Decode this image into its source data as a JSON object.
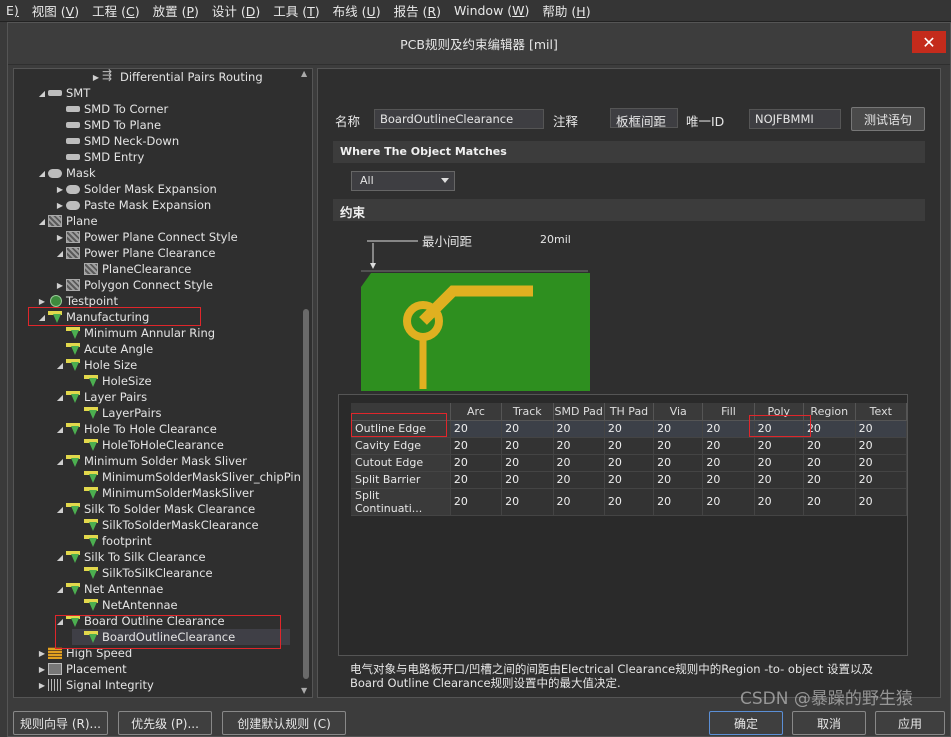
{
  "menubar": {
    "items": [
      {
        "label": "E",
        "key": ")"
      },
      {
        "label": "视图 (",
        "key": "V",
        "end": ")"
      },
      {
        "label": "工程 (",
        "key": "C",
        "end": ")"
      },
      {
        "label": "放置 (",
        "key": "P",
        "end": ")"
      },
      {
        "label": "设计 (",
        "key": "D",
        "end": ")"
      },
      {
        "label": "工具 (",
        "key": "T",
        "end": ")"
      },
      {
        "label": "布线 (",
        "key": "U",
        "end": ")"
      },
      {
        "label": "报告 (",
        "key": "R",
        "end": ")"
      },
      {
        "label": "Window (",
        "key": "W",
        "end": ")"
      },
      {
        "label": "帮助 (",
        "key": "H",
        "end": ")"
      }
    ]
  },
  "dialog": {
    "title": "PCB规则及约束编辑器 [mil]",
    "close": "✕"
  },
  "tree": {
    "items": [
      {
        "label": "Differential Pairs Routing",
        "arrow": "▶",
        "icon": "diff"
      },
      {
        "label": "SMT",
        "arrow": "◢",
        "icon": "smt"
      },
      {
        "label": "SMD To Corner",
        "arrow": "",
        "icon": "smt"
      },
      {
        "label": "SMD To Plane",
        "arrow": "",
        "icon": "smt"
      },
      {
        "label": "SMD Neck-Down",
        "arrow": "",
        "icon": "smt"
      },
      {
        "label": "SMD Entry",
        "arrow": "",
        "icon": "smt"
      },
      {
        "label": "Mask",
        "arrow": "◢",
        "icon": "pill"
      },
      {
        "label": "Solder Mask Expansion",
        "arrow": "▶",
        "icon": "pill"
      },
      {
        "label": "Paste Mask Expansion",
        "arrow": "▶",
        "icon": "pill"
      },
      {
        "label": "Plane",
        "arrow": "◢",
        "icon": "checker"
      },
      {
        "label": "Power Plane Connect Style",
        "arrow": "▶",
        "icon": "checker"
      },
      {
        "label": "Power Plane Clearance",
        "arrow": "◢",
        "icon": "checker"
      },
      {
        "label": "PlaneClearance",
        "arrow": "",
        "icon": "checker"
      },
      {
        "label": "Polygon Connect Style",
        "arrow": "▶",
        "icon": "checker"
      },
      {
        "label": "Testpoint",
        "arrow": "▶",
        "icon": "testpoint"
      },
      {
        "label": "Manufacturing",
        "arrow": "◢",
        "icon": "mfg"
      },
      {
        "label": "Minimum Annular Ring",
        "arrow": "",
        "icon": "mfg"
      },
      {
        "label": "Acute Angle",
        "arrow": "",
        "icon": "mfg"
      },
      {
        "label": "Hole Size",
        "arrow": "◢",
        "icon": "mfg"
      },
      {
        "label": "HoleSize",
        "arrow": "",
        "icon": "mfg"
      },
      {
        "label": "Layer Pairs",
        "arrow": "◢",
        "icon": "mfg"
      },
      {
        "label": "LayerPairs",
        "arrow": "",
        "icon": "mfg"
      },
      {
        "label": "Hole To Hole Clearance",
        "arrow": "◢",
        "icon": "mfg"
      },
      {
        "label": "HoleToHoleClearance",
        "arrow": "",
        "icon": "mfg"
      },
      {
        "label": "Minimum Solder Mask Sliver",
        "arrow": "◢",
        "icon": "mfg"
      },
      {
        "label": "MinimumSolderMaskSliver_chipPin",
        "arrow": "",
        "icon": "mfg"
      },
      {
        "label": "MinimumSolderMaskSliver",
        "arrow": "",
        "icon": "mfg"
      },
      {
        "label": "Silk To Solder Mask Clearance",
        "arrow": "◢",
        "icon": "mfg"
      },
      {
        "label": "SilkToSolderMaskClearance",
        "arrow": "",
        "icon": "mfg"
      },
      {
        "label": "footprint",
        "arrow": "",
        "icon": "mfg"
      },
      {
        "label": "Silk To Silk Clearance",
        "arrow": "◢",
        "icon": "mfg"
      },
      {
        "label": "SilkToSilkClearance",
        "arrow": "",
        "icon": "mfg"
      },
      {
        "label": "Net Antennae",
        "arrow": "◢",
        "icon": "mfg"
      },
      {
        "label": "NetAntennae",
        "arrow": "",
        "icon": "mfg"
      },
      {
        "label": "Board Outline Clearance",
        "arrow": "◢",
        "icon": "mfg"
      },
      {
        "label": "BoardOutlineClearance",
        "arrow": "",
        "icon": "mfg"
      },
      {
        "label": "High Speed",
        "arrow": "▶",
        "icon": "hs"
      },
      {
        "label": "Placement",
        "arrow": "▶",
        "icon": "place"
      },
      {
        "label": "Signal Integrity",
        "arrow": "▶",
        "icon": "signal"
      }
    ]
  },
  "rule": {
    "name_label": "名称",
    "name_value": "BoardOutlineClearance",
    "comment_label": "注释",
    "comment_value": "板框间距",
    "uid_label": "唯一ID",
    "uid_value": "NOJFBMMI",
    "test_button": "测试语句"
  },
  "match": {
    "header": "Where The Object Matches",
    "selected": "All"
  },
  "constraints": {
    "header": "约束",
    "min_clearance_label": "最小间距",
    "min_clearance_value": "20mil"
  },
  "grid": {
    "columns": [
      "Arc",
      "Track",
      "SMD Pad",
      "TH Pad",
      "Via",
      "Fill",
      "Poly",
      "Region",
      "Text"
    ],
    "rows": [
      {
        "name": "Outline Edge",
        "values": [
          "20",
          "20",
          "20",
          "20",
          "20",
          "20",
          "20",
          "20",
          "20"
        ]
      },
      {
        "name": "Cavity Edge",
        "values": [
          "20",
          "20",
          "20",
          "20",
          "20",
          "20",
          "20",
          "20",
          "20"
        ]
      },
      {
        "name": "Cutout Edge",
        "values": [
          "20",
          "20",
          "20",
          "20",
          "20",
          "20",
          "20",
          "20",
          "20"
        ]
      },
      {
        "name": "Split Barrier",
        "values": [
          "20",
          "20",
          "20",
          "20",
          "20",
          "20",
          "20",
          "20",
          "20"
        ]
      },
      {
        "name": "Split Continuati...",
        "values": [
          "20",
          "20",
          "20",
          "20",
          "20",
          "20",
          "20",
          "20",
          "20"
        ]
      }
    ]
  },
  "description": {
    "line1": "电气对象与电路板开口/凹槽之间的间距由Electrical Clearance规则中的Region -to- object 设置以及",
    "line2": "Board Outline Clearance规则设置中的最大值决定."
  },
  "footer": {
    "rule_wizard": "规则向导 (R)...",
    "priorities": "优先级 (P)...",
    "create_default": "创建默认规则 (C)",
    "ok": "确定",
    "cancel": "取消",
    "apply": "应用"
  },
  "watermark": "CSDN @暴躁的野生猿",
  "colors": {
    "board_green": "#2e8f1f",
    "track_yellow": "#e0b020",
    "highlight_red": "#e0262b",
    "selected_cell": "#4a6791"
  }
}
